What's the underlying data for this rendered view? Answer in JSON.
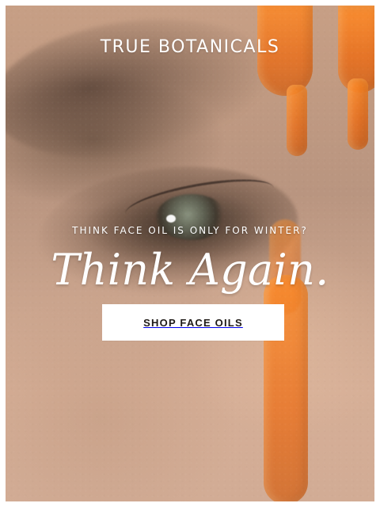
{
  "brand": {
    "name": "TRUE BOTANICALS"
  },
  "hero": {
    "kicker": "THINK FACE OIL IS ONLY FOR WINTER?",
    "headline": "Think Again.",
    "cta_label": "SHOP FACE OILS",
    "accent_oil_color": "#F28A2B",
    "text_color": "#FFFFFF"
  }
}
